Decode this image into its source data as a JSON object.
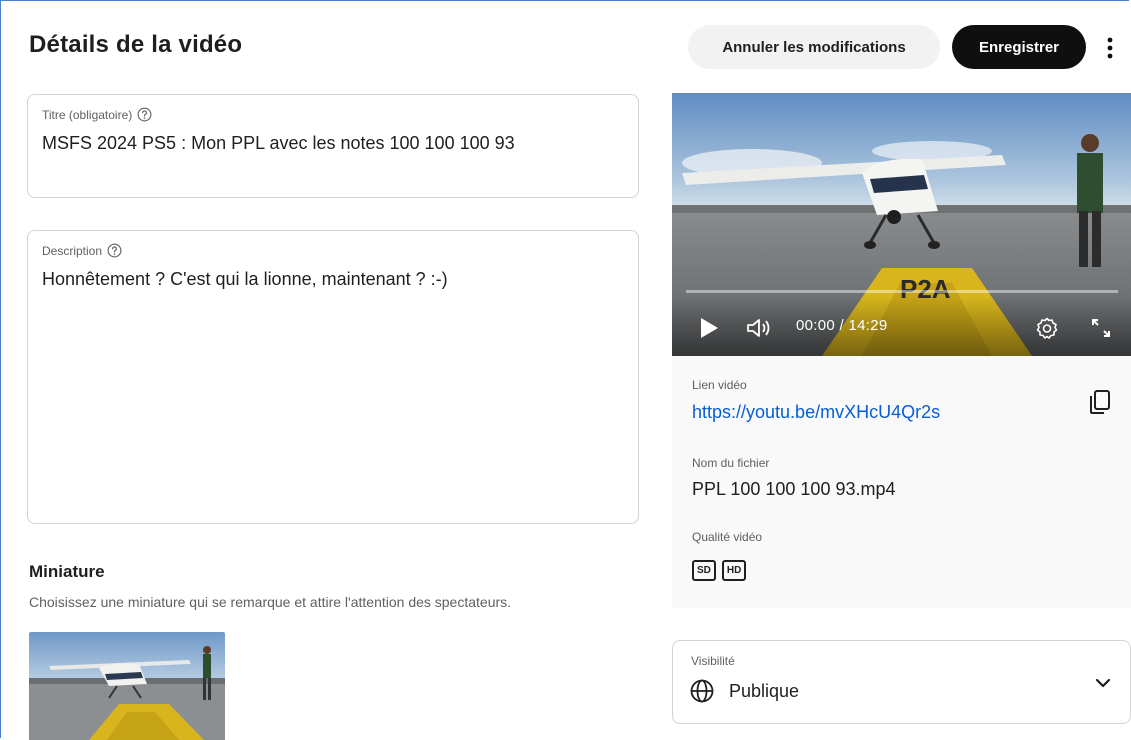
{
  "header": {
    "title": "Détails de la vidéo",
    "cancel_label": "Annuler les modifications",
    "save_label": "Enregistrer",
    "more_icon": "more-vert-icon"
  },
  "form": {
    "title_field": {
      "label": "Titre (obligatoire)",
      "value": "MSFS 2024 PS5 : Mon PPL avec les notes 100 100 100 93"
    },
    "description_field": {
      "label": "Description",
      "value": "Honnêtement ? C'est qui la lionne, maintenant ? :-)"
    }
  },
  "thumbnail": {
    "title": "Miniature",
    "subtitle": "Choisissez une miniature qui se remarque et attire l'attention des spectateurs."
  },
  "player": {
    "time": "00:00 / 14:29",
    "progress": 0
  },
  "video_info": {
    "link_label": "Lien vidéo",
    "link": "https://youtu.be/mvXHcU4Qr2s",
    "filename_label": "Nom du fichier",
    "filename": "PPL 100 100 100 93.mp4",
    "quality_label": "Qualité vidéo",
    "quality_badges": [
      "SD",
      "HD"
    ]
  },
  "visibility": {
    "label": "Visibilité",
    "value": "Publique"
  },
  "colors": {
    "accent_link": "#065fd4",
    "save_button": "#0f0f0f",
    "cancel_button": "#f2f2f2"
  }
}
